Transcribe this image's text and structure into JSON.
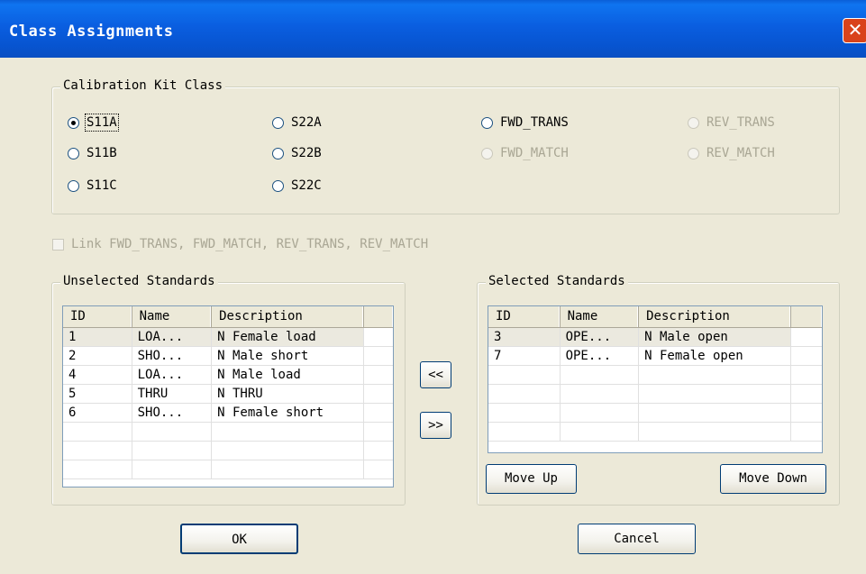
{
  "window": {
    "title": "Class Assignments"
  },
  "cal_kit_class": {
    "legend": "Calibration Kit Class",
    "options": [
      {
        "label": "S11A",
        "selected": true,
        "enabled": true
      },
      {
        "label": "S22A",
        "selected": false,
        "enabled": true
      },
      {
        "label": "FWD_TRANS",
        "selected": false,
        "enabled": true
      },
      {
        "label": "REV_TRANS",
        "selected": false,
        "enabled": false
      },
      {
        "label": "S11B",
        "selected": false,
        "enabled": true
      },
      {
        "label": "S22B",
        "selected": false,
        "enabled": true
      },
      {
        "label": "FWD_MATCH",
        "selected": false,
        "enabled": false
      },
      {
        "label": "REV_MATCH",
        "selected": false,
        "enabled": false
      },
      {
        "label": "S11C",
        "selected": false,
        "enabled": true
      },
      {
        "label": "S22C",
        "selected": false,
        "enabled": true
      }
    ]
  },
  "link_checkbox": {
    "label": "Link FWD_TRANS, FWD_MATCH, REV_TRANS, REV_MATCH",
    "checked": false,
    "enabled": false
  },
  "unselected": {
    "legend": "Unselected Standards",
    "columns": [
      "ID",
      "Name",
      "Description"
    ],
    "rows": [
      [
        "1",
        "LOA...",
        "N Female load"
      ],
      [
        "2",
        "SHO...",
        "N Male short"
      ],
      [
        "4",
        "LOA...",
        "N Male load"
      ],
      [
        "5",
        "THRU",
        "N THRU"
      ],
      [
        "6",
        "SHO...",
        "N Female short"
      ]
    ]
  },
  "selected": {
    "legend": "Selected Standards",
    "columns": [
      "ID",
      "Name",
      "Description"
    ],
    "rows": [
      [
        "3",
        "OPE...",
        "N Male open"
      ],
      [
        "7",
        "OPE...",
        "N Female open"
      ]
    ]
  },
  "buttons": {
    "move_left": "<<",
    "move_right": ">>",
    "move_up": "Move Up",
    "move_down": "Move Down",
    "ok": "OK",
    "cancel": "Cancel"
  }
}
